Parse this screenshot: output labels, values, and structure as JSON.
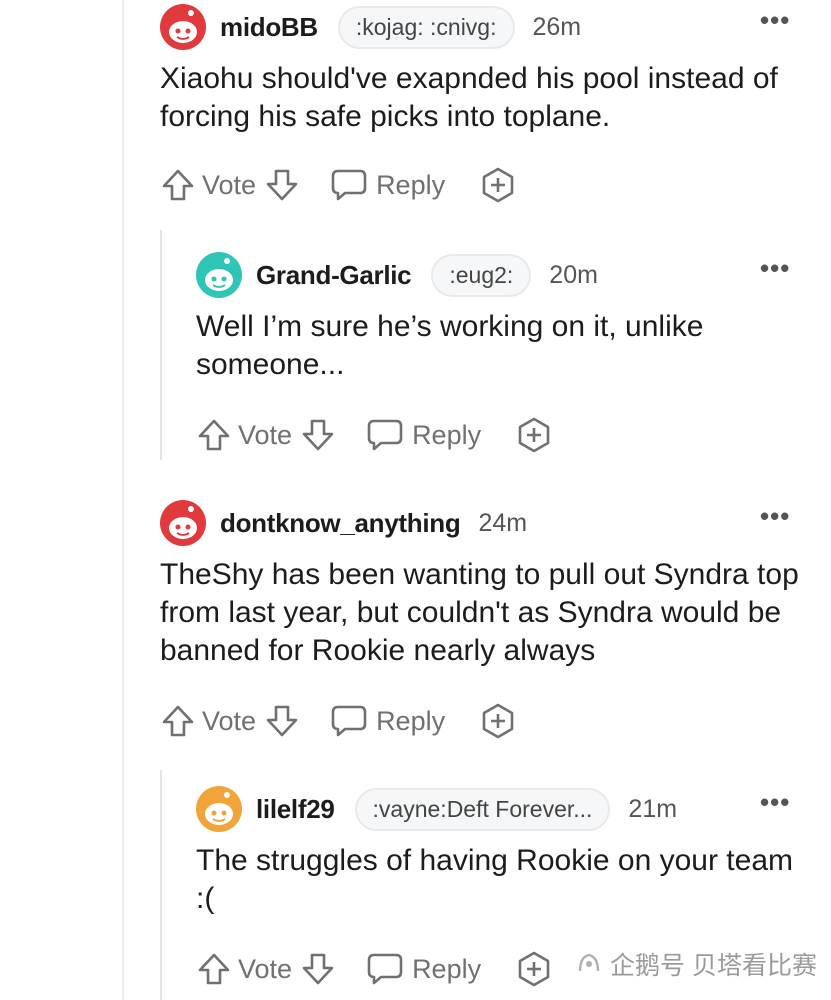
{
  "comments": [
    {
      "username": "midoBB",
      "flair": ":kojag: :cnivg:",
      "time": "26m",
      "body": "Xiaohu should've exapnded his pool instead of forcing his safe picks into toplane.",
      "vote_label": "Vote",
      "reply_label": "Reply",
      "more": "•••",
      "avatar_color": "#e0393e"
    },
    {
      "username": "Grand-Garlic",
      "flair": ":eug2:",
      "time": "20m",
      "body": "Well I’m sure he’s working on it, unlike someone...",
      "vote_label": "Vote",
      "reply_label": "Reply",
      "more": "•••",
      "avatar_color": "#2ec4b6"
    },
    {
      "username": "dontknow_anything",
      "flair": "",
      "time": "24m",
      "body": "TheShy has been wanting to pull out Syndra top from last year, but couldn't as Syndra would be banned for Rookie nearly always",
      "vote_label": "Vote",
      "reply_label": "Reply",
      "more": "•••",
      "avatar_color": "#e0393e"
    },
    {
      "username": "lilelf29",
      "flair": ":vayne:Deft Forever...",
      "time": "21m",
      "body": "The struggles of having Rookie on your team :(",
      "vote_label": "Vote",
      "reply_label": "Reply",
      "more": "•••",
      "avatar_color": "#f0a43a"
    }
  ],
  "watermark": {
    "text": "企鹅号 贝塔看比赛"
  },
  "icons": [
    "upvote-arrow-icon",
    "downvote-arrow-icon",
    "reply-bubble-icon",
    "award-plus-icon",
    "more-dots-icon",
    "snoo-avatar-icon"
  ]
}
